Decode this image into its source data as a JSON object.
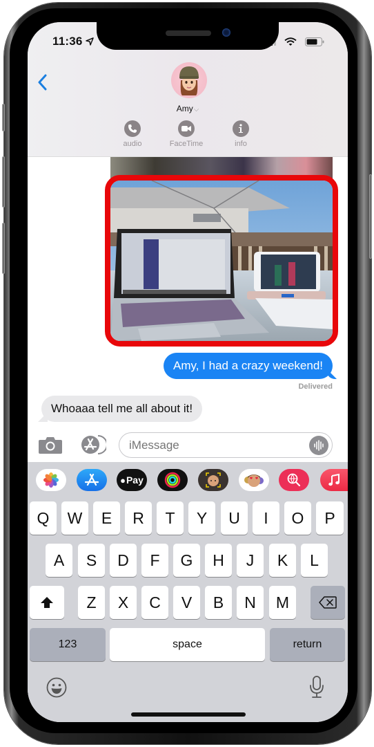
{
  "status_bar": {
    "time": "11:36",
    "location_icon": "location-arrow-icon",
    "signal_icon": "cellular-signal-icon",
    "wifi_icon": "wifi-icon",
    "battery_icon": "battery-icon"
  },
  "header": {
    "back_icon": "chevron-left-icon",
    "contact_name": "Amy",
    "contact_chevron": "⌵",
    "actions": [
      {
        "label": "audio",
        "icon": "phone-icon"
      },
      {
        "label": "FaceTime",
        "icon": "video-camera-icon"
      },
      {
        "label": "info",
        "icon": "info-icon"
      }
    ]
  },
  "messages": [
    {
      "type": "image",
      "direction": "outgoing",
      "description": "Flowered fabric photo (partially scrolled)"
    },
    {
      "type": "image",
      "direction": "outgoing",
      "description": "Laptop and iPad on a glass table outdoors",
      "highlighted": true,
      "highlight_color": "#e8070a"
    },
    {
      "type": "text",
      "direction": "outgoing",
      "text": "Amy, I had a crazy weekend!"
    },
    {
      "type": "status",
      "text": "Delivered"
    },
    {
      "type": "text",
      "direction": "incoming",
      "text": "Whoaaa tell me all about it!"
    }
  ],
  "input_bar": {
    "camera_icon": "camera-icon",
    "apps_icon": "app-store-icon",
    "placeholder": "iMessage",
    "value": "",
    "audio_icon": "audio-waveform-icon"
  },
  "app_drawer": [
    {
      "name": "Photos",
      "icon": "photos-icon"
    },
    {
      "name": "App Store",
      "icon": "app-store-icon"
    },
    {
      "name": "Apple Pay",
      "label": "Pay",
      "icon": "apple-pay-icon"
    },
    {
      "name": "Activity",
      "icon": "activity-rings-icon"
    },
    {
      "name": "Memoji",
      "icon": "memoji-icon"
    },
    {
      "name": "Memoji Stickers",
      "icon": "memoji-stickers-icon"
    },
    {
      "name": "Images Search",
      "icon": "globe-search-icon"
    },
    {
      "name": "Music",
      "icon": "music-icon"
    }
  ],
  "keyboard": {
    "row1": [
      "Q",
      "W",
      "E",
      "R",
      "T",
      "Y",
      "U",
      "I",
      "O",
      "P"
    ],
    "row2": [
      "A",
      "S",
      "D",
      "F",
      "G",
      "H",
      "J",
      "K",
      "L"
    ],
    "row3": [
      "Z",
      "X",
      "C",
      "V",
      "B",
      "N",
      "M"
    ],
    "numbers_label": "123",
    "space_label": "space",
    "return_label": "return",
    "shift_icon": "shift-icon",
    "delete_icon": "delete-backspace-icon",
    "emoji_icon": "emoji-smiley-icon",
    "mic_icon": "microphone-icon"
  },
  "colors": {
    "imessage_blue": "#1a84f4",
    "incoming_gray": "#e9e9eb",
    "highlight_red": "#e8070a",
    "link_blue": "#1a7fe0"
  }
}
